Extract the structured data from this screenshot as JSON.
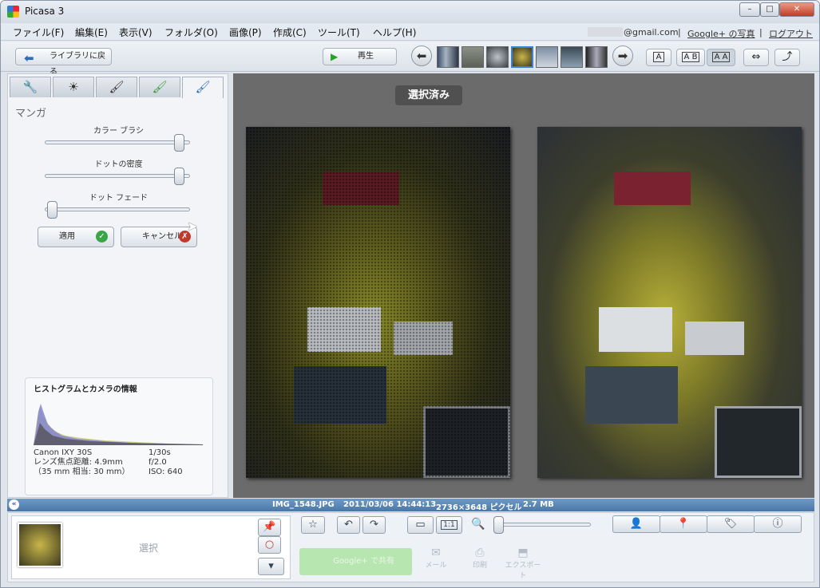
{
  "window": {
    "title": "Picasa 3",
    "minimize": "–",
    "maximize": "□",
    "close": "✕"
  },
  "menu": [
    "ファイル(F)",
    "編集(E)",
    "表示(V)",
    "フォルダ(O)",
    "画像(P)",
    "作成(C)",
    "ツール(T)",
    "ヘルプ(H)"
  ],
  "account": {
    "email": "@gmail.com",
    "sep1": "|",
    "photos_link": "Google+ の写真",
    "sep2": "|",
    "logout": "ログアウト"
  },
  "toolbar": {
    "back_label": "ライブラリに戻る",
    "play_label": "再生",
    "view_single": "A",
    "view_compare": "A B",
    "view_compare_active": "A A"
  },
  "edit_panel": {
    "effect_title": "マンガ",
    "slider1_label": "カラー ブラシ",
    "slider2_label": "ドットの密度",
    "slider3_label": "ドット フェード",
    "slider1_value": 0.97,
    "slider2_value": 0.97,
    "slider3_value": 0.02,
    "apply_label": "適用",
    "cancel_label": "キャンセル"
  },
  "histogram": {
    "title": "ヒストグラムとカメラの情報",
    "camera": "Canon IXY 30S",
    "focal": "レンズ焦点距離: 4.9mm",
    "equiv": "（35 mm 相当:  30 mm）",
    "shutter": "1/30s",
    "aperture": "f/2.0",
    "iso": "ISO: 640"
  },
  "preview": {
    "badge": "選択済み"
  },
  "status": {
    "filename": "IMG_1548.JPG",
    "datetime": "2011/03/06 14:44:13",
    "dimensions": "2736×3648 ピクセル",
    "filesize": "2.7 MB"
  },
  "tray": {
    "selection_label": "選択",
    "share_label": "Google+ で共有",
    "mail_label": "メール",
    "print_label": "印刷",
    "export_label": "エクスポート",
    "zoom_1to1": "1:1",
    "zoom_value": 0.0
  },
  "colors": {
    "accent": "#3b82d6",
    "status_bar": "#4a77a7",
    "apply_icon": "#3aa547",
    "cancel_icon": "#c0392b",
    "preview_bg": "#6b6b6b"
  }
}
